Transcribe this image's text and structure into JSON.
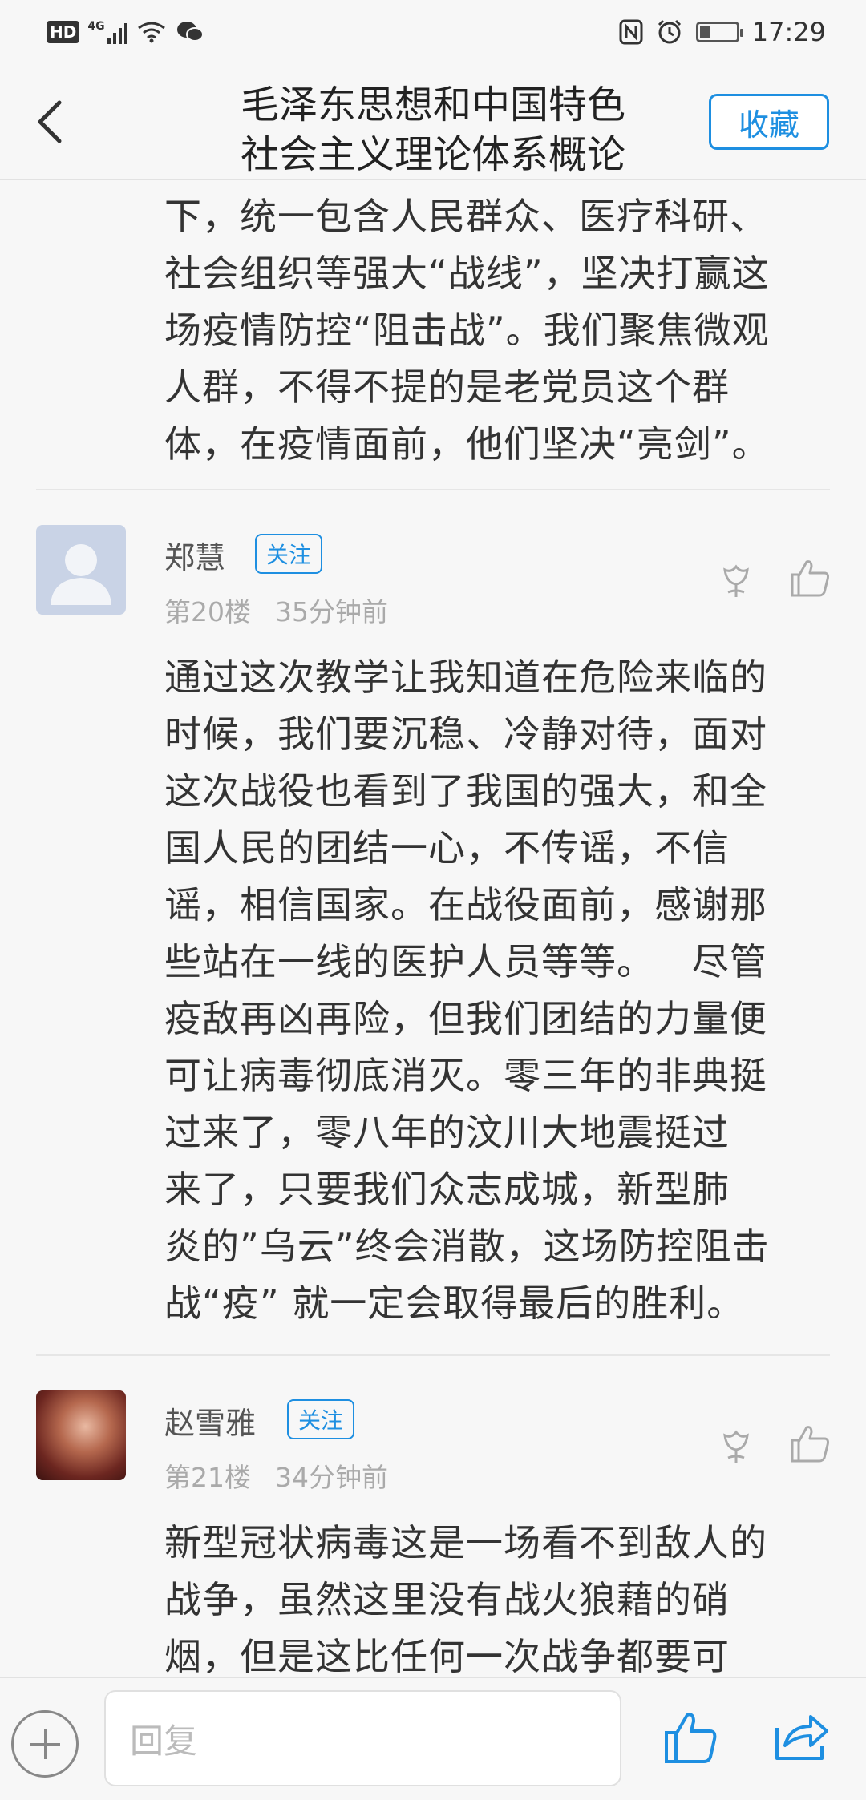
{
  "status_bar": {
    "left_badge": "HD",
    "network": "4G",
    "time": "17:29"
  },
  "header": {
    "title_line1": "毛泽东思想和中国特色",
    "title_line2": "社会主义理论体系概论",
    "collect_label": "收藏"
  },
  "previous_comment": {
    "lines": [
      "下，统一包含人民群众、医疗科研、",
      "社会组织等强大“战线”，坚决打赢这",
      "场疫情防控“阻击战”。我们聚焦微观",
      "人群，不得不提的是老党员这个群",
      "体，在疫情面前，他们坚决“亮剑”。"
    ]
  },
  "comments": [
    {
      "username": "郑慧",
      "follow_label": "关注",
      "floor": "第20楼",
      "time": "35分钟前",
      "lines": [
        "通过这次教学让我知道在危险来临的",
        "时候，我们要沉稳、冷静对待，面对",
        "这次战役也看到了我国的强大，和全",
        "国人民的团结一心，不传谣，不信",
        "谣，相信国家。在战役面前，感谢那",
        "些站在一线的医护人员等等。   尽管",
        "疫敌再凶再险，但我们团结的力量便",
        "可让病毒彻底消灭。零三年的非典挺",
        "过来了，零八年的汶川大地震挺过",
        "来了，只要我们众志成城，新型肺",
        "炎的”乌云”终会消散，这场防控阻击",
        "战“疫” 就一定会取得最后的胜利。"
      ]
    },
    {
      "username": "赵雪雅",
      "follow_label": "关注",
      "floor": "第21楼",
      "time": "34分钟前",
      "lines": [
        "新型冠状病毒这是一场看不到敌人的",
        "战争，虽然这里没有战火狼藉的硝",
        "烟，但是这比任何一次战争都要可"
      ]
    }
  ],
  "bottom_bar": {
    "reply_placeholder": "回复"
  },
  "colors": {
    "accent": "#1e8fe1",
    "background": "#f7f7f7",
    "text": "#333333",
    "meta": "#aaaaaa"
  },
  "icons": [
    "back-arrow-icon",
    "flower-icon",
    "thumbs-up-icon",
    "plus-icon",
    "share-icon",
    "wifi-icon",
    "alarm-icon",
    "nfc-icon",
    "battery-icon",
    "signal-icon",
    "wechat-icon"
  ]
}
